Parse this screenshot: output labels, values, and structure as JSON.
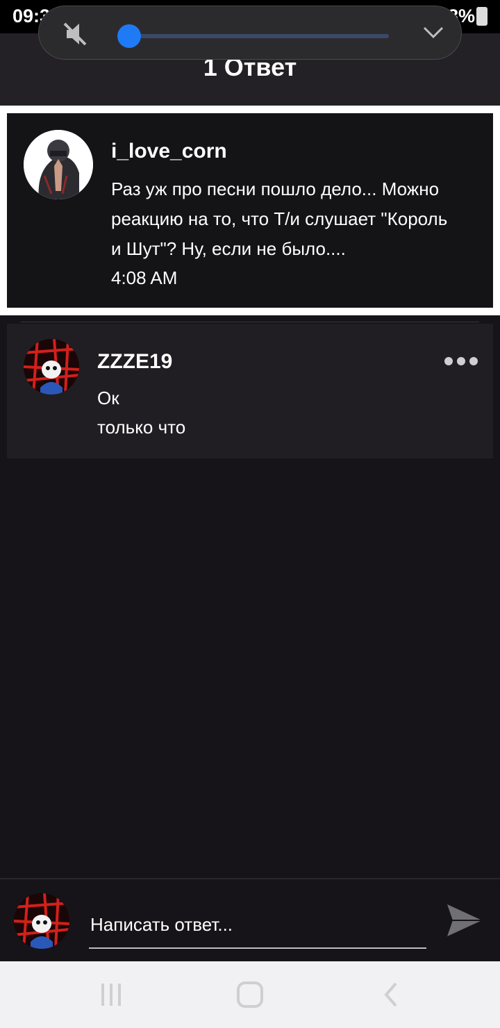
{
  "status_bar": {
    "time": "09:34",
    "battery": "98%"
  },
  "volume": {
    "level": 0.04,
    "accent_color": "#1f7af6"
  },
  "header": {
    "title": "1 Ответ"
  },
  "parent_comment": {
    "author": "i_love_corn",
    "lines": [
      "Раз уж про песни пошло дело... Можно",
      "реакцию на то, что Т/и слушает \"Король",
      "и Шут\"? Ну, если не было...."
    ],
    "time": "4:08 AM"
  },
  "reply": {
    "author": "ZZZE19",
    "text": "Ок",
    "time": "только что"
  },
  "composer": {
    "placeholder": "Написать ответ..."
  },
  "icons": {
    "mute": "mute-icon",
    "chevron": "chevron-down-icon",
    "more": "more-icon",
    "send": "send-icon",
    "recents": "recents-icon",
    "home": "home-icon",
    "back": "back-icon"
  }
}
